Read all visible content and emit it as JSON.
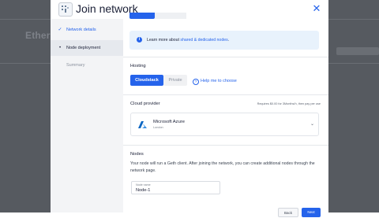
{
  "background": {
    "app_title": "Ethere"
  },
  "modal": {
    "title": "Join network",
    "close_icon": "close-icon",
    "steps": [
      {
        "label": "Network details",
        "state": "done",
        "mark": "✓"
      },
      {
        "label": "Node deployment",
        "state": "active",
        "mark": "•"
      },
      {
        "label": "Summary",
        "state": "pending",
        "mark": ""
      }
    ],
    "info": {
      "prefix": "Learn more about ",
      "link": "shared & dedicated nodes",
      "suffix": "."
    },
    "hosting": {
      "label": "Hosting",
      "options": [
        "Cloudstack",
        "Private"
      ],
      "selected": "Cloudstack",
      "help": "Help me to choose"
    },
    "cloud": {
      "label": "Cloud provider",
      "price_note": "Requires $0.00 for 3Months/h, then pay per use",
      "provider": "Microsoft Azure",
      "region": "London"
    },
    "nodes": {
      "label": "Nodes",
      "description": "Your node will run a Geth client. After joining the network, you can create additional nodes through the network page.",
      "field_label": "Node name",
      "field_value": "Node-1"
    },
    "footer": {
      "back": "Back",
      "next": "Next"
    }
  },
  "colors": {
    "accent": "#2563eb",
    "overlay": "#565a60"
  }
}
